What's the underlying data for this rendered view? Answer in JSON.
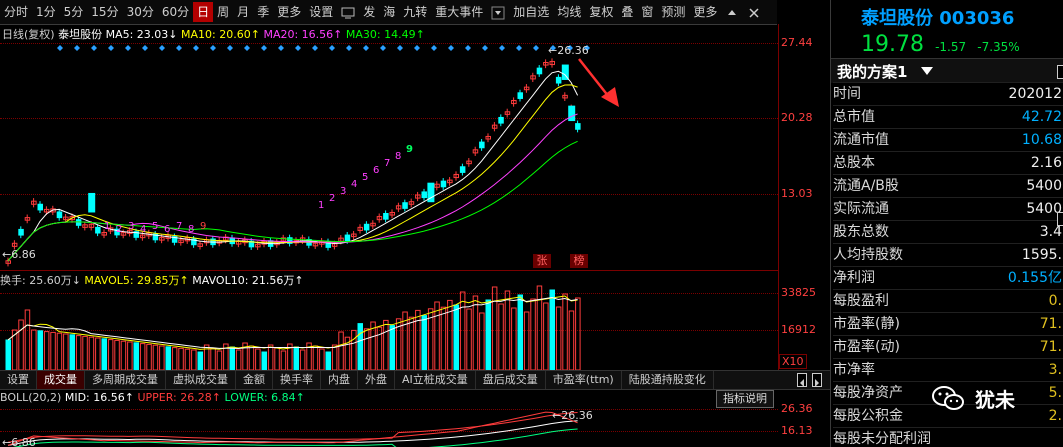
{
  "toolbar": {
    "items": [
      "分时",
      "1分",
      "5分",
      "15分",
      "30分",
      "60分",
      "日",
      "周",
      "月",
      "季",
      "更多",
      "设置",
      "发",
      "海",
      "九转",
      "重大事件",
      "加自选",
      "均线",
      "复权",
      "叠",
      "窗",
      "预测",
      "更多"
    ],
    "selected": "日"
  },
  "chart": {
    "legend": {
      "prefix": "日线(复权)",
      "name": "泰坦股份",
      "ma5": "MA5: 23.03↓",
      "ma10": "MA10: 20.60↑",
      "ma20": "MA20: 16.56↑",
      "ma30": "MA30: 14.49↑"
    },
    "price_axis": [
      "27.44",
      "20.28",
      "13.03"
    ],
    "high_marker": "26.36",
    "low_marker": "6.86",
    "td_numbers_low": [
      "1",
      "2",
      "3",
      "4",
      "5",
      "6",
      "7",
      "8",
      "9"
    ],
    "td_numbers_high": [
      "1",
      "2",
      "3",
      "4",
      "5",
      "6",
      "7",
      "8",
      "9"
    ],
    "tags": [
      "张",
      "榜"
    ]
  },
  "volume": {
    "legend": {
      "prefix": "换手: 25.60万↓",
      "mavol5": "MAVOL5: 29.85万↑",
      "mavol10": "MAVOL10: 21.56万↑"
    },
    "axis": [
      "33825",
      "16912",
      "X10"
    ]
  },
  "tabs": [
    "设置",
    "成交量",
    "多周期成交量",
    "虚拟成交量",
    "金额",
    "换手率",
    "内盘",
    "外盘",
    "AI立桩成交量",
    "盘后成交量",
    "市盈率(ttm)",
    "陆股通持股变化"
  ],
  "tab_selected": "成交量",
  "boll": {
    "prefix": "BOLL(20,2)",
    "mid": "MID: 16.56↑",
    "upper": "UPPER: 26.28↑",
    "lower": "LOWER: 6.84↑",
    "axis": [
      "26.36",
      "16.13"
    ],
    "low_marker": "6.86",
    "high_marker": "26.36",
    "help": "指标说明"
  },
  "panel": {
    "stock_name": "泰坦股份",
    "code": "003036",
    "price": "19.78",
    "change": "-1.57",
    "change_pct": "-7.35%",
    "scheme": "我的方案1",
    "rows": [
      {
        "label": "时间",
        "value": "202012"
      },
      {
        "label": "总市值",
        "value": "42.72"
      },
      {
        "label": "流通市值",
        "value": "10.68"
      },
      {
        "label": "总股本",
        "value": "2.16"
      },
      {
        "label": "流通A/B股",
        "value": "5400"
      },
      {
        "label": "实际流通",
        "value": "5400"
      },
      {
        "label": "股东总数",
        "value": "3.4"
      },
      {
        "label": "人均持股数",
        "value": "1595."
      },
      {
        "label": "净利润",
        "value": "0.155亿"
      },
      {
        "label": "每股盈利",
        "value": "0."
      },
      {
        "label": "市盈率(静)",
        "value": "71."
      },
      {
        "label": "市盈率(动)",
        "value": "71."
      },
      {
        "label": "市净率",
        "value": "3."
      },
      {
        "label": "每股净资产",
        "value": "5."
      },
      {
        "label": "每股公积金",
        "value": "2."
      },
      {
        "label": "每股未分配利润",
        "value": ""
      }
    ]
  },
  "watermark": "犹未",
  "colors": {
    "up": "#ff3c3c",
    "down": "#00ffff",
    "ma5": "#ffffff",
    "ma10": "#ffff00",
    "ma20": "#ff40ff",
    "ma30": "#00ff00",
    "accent": "#b30000"
  }
}
